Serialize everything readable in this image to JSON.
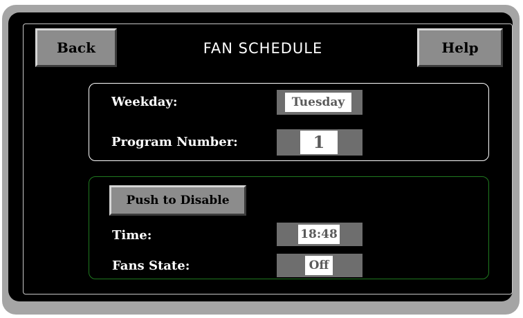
{
  "header": {
    "back_label": "Back",
    "title": "FAN SCHEDULE",
    "help_label": "Help"
  },
  "schedule_panel": {
    "weekday_label": "Weekday:",
    "weekday_value": "Tuesday",
    "program_label": "Program Number:",
    "program_value": "1"
  },
  "status_panel": {
    "disable_button_label": "Push to Disable",
    "time_label": "Time:",
    "time_value": "18:48",
    "fans_state_label": "Fans State:",
    "fans_state_value": "Off"
  },
  "colors": {
    "bezel": "#a5a5a5",
    "background": "#000000",
    "button_face": "#8c8c8c",
    "schedule_panel_border": "#ffffff",
    "status_panel_border": "#1f7a1f"
  }
}
